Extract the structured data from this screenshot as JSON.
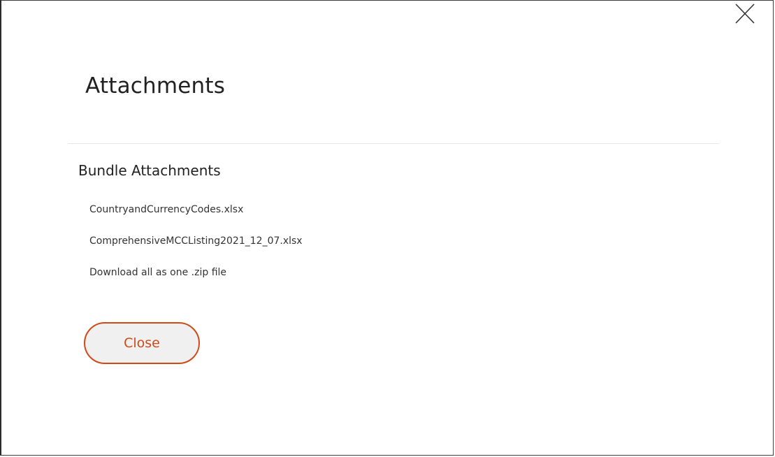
{
  "dialog": {
    "title": "Attachments",
    "section_heading": "Bundle Attachments",
    "attachments": [
      "CountryandCurrencyCodes.xlsx",
      "ComprehensiveMCCListing2021_12_07.xlsx",
      "Download all as one .zip file"
    ],
    "close_button_label": "Close",
    "close_icon": "close-icon"
  },
  "colors": {
    "accent": "#cf4a16",
    "button_bg": "#f0f0f0",
    "text": "#222222",
    "divider": "#e6e6e6"
  }
}
